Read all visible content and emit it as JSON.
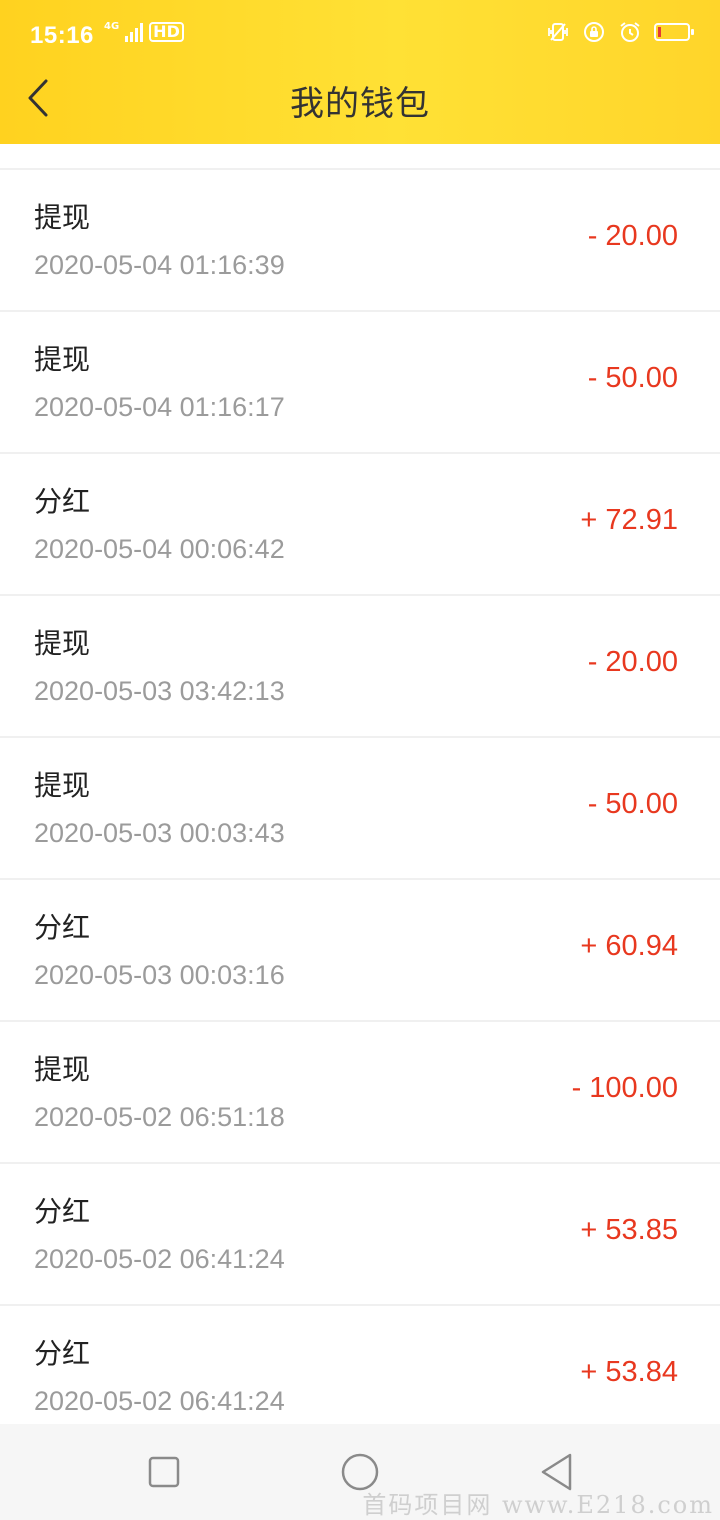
{
  "status_bar": {
    "time": "15:16",
    "network": "4G",
    "hd": "HD",
    "icons": [
      "vibrate-icon",
      "rotation-lock-icon",
      "alarm-icon",
      "battery-icon"
    ],
    "battery_level": 0.1
  },
  "header": {
    "title": "我的钱包",
    "back_icon": "chevron-left-icon",
    "bg_color": "#FFD82A"
  },
  "colors": {
    "amount": "#E8381F",
    "time": "#9b9b9b"
  },
  "transactions": [
    {
      "title": "提现",
      "time": "2020-05-04 01:16:39",
      "amount": "- 20.00"
    },
    {
      "title": "提现",
      "time": "2020-05-04 01:16:17",
      "amount": "- 50.00"
    },
    {
      "title": "分红",
      "time": "2020-05-04 00:06:42",
      "amount": "+ 72.91"
    },
    {
      "title": "提现",
      "time": "2020-05-03 03:42:13",
      "amount": "- 20.00"
    },
    {
      "title": "提现",
      "time": "2020-05-03 00:03:43",
      "amount": "- 50.00"
    },
    {
      "title": "分红",
      "time": "2020-05-03 00:03:16",
      "amount": "+ 60.94"
    },
    {
      "title": "提现",
      "time": "2020-05-02 06:51:18",
      "amount": "- 100.00"
    },
    {
      "title": "分红",
      "time": "2020-05-02 06:41:24",
      "amount": "+ 53.85"
    },
    {
      "title": "分红",
      "time": "2020-05-02 06:41:24",
      "amount": "+ 53.84"
    }
  ],
  "system_nav": {
    "buttons": [
      "recents-square-icon",
      "home-circle-icon",
      "back-triangle-icon"
    ]
  },
  "watermark": "首码项目网 www.E218.com"
}
